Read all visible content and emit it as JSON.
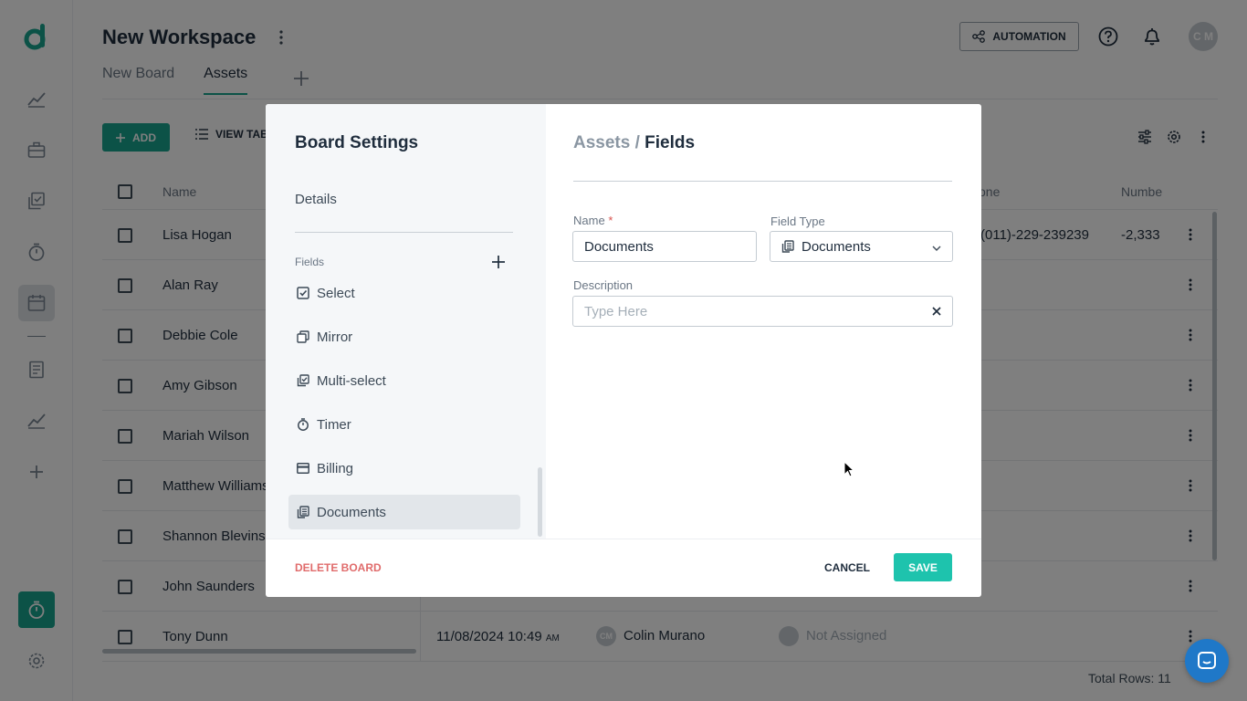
{
  "header": {
    "title": "New Workspace",
    "automation_label": "AUTOMATION",
    "avatar_initials": "C M"
  },
  "tabs": [
    {
      "label": "New Board"
    },
    {
      "label": "Assets"
    }
  ],
  "toolbar": {
    "add_label": "ADD",
    "view_label": "VIEW TAB"
  },
  "table": {
    "headers": {
      "name": "Name",
      "phone": "one",
      "number": "Numbe"
    },
    "rows": [
      {
        "name": "Lisa Hogan",
        "phone": "(011)-229-239239",
        "number": "-2,333"
      },
      {
        "name": "Alan Ray"
      },
      {
        "name": "Debbie Cole"
      },
      {
        "name": "Amy Gibson"
      },
      {
        "name": "Mariah Wilson"
      },
      {
        "name": "Matthew Williams"
      },
      {
        "name": "Shannon Blevins"
      },
      {
        "name": "John Saunders"
      },
      {
        "name": "Tony Dunn",
        "date": "11/08/2024 10:49",
        "ampm": "AM",
        "owner_initials": "CM",
        "owner": "Colin Murano",
        "assignee": "Not Assigned"
      }
    ],
    "total_rows": "Total Rows: 11"
  },
  "modal": {
    "title": "Board Settings",
    "nav_details": "Details",
    "fields_label": "Fields",
    "field_items": [
      {
        "label": "Select",
        "icon": "checkbox-icon"
      },
      {
        "label": "Mirror",
        "icon": "mirror-icon"
      },
      {
        "label": "Multi-select",
        "icon": "multi-select-icon"
      },
      {
        "label": "Timer",
        "icon": "timer-icon"
      },
      {
        "label": "Billing",
        "icon": "billing-card-icon"
      },
      {
        "label": "Documents",
        "icon": "documents-icon"
      }
    ],
    "breadcrumb": {
      "parent": "Assets",
      "separator": "/",
      "current": "Fields"
    },
    "name_label": "Name",
    "name_required": "*",
    "name_value": "Documents",
    "field_type_label": "Field Type",
    "field_type_value": "Documents",
    "description_label": "Description",
    "description_placeholder": "Type Here",
    "delete_label": "DELETE BOARD",
    "cancel_label": "CANCEL",
    "save_label": "SAVE"
  },
  "colors": {
    "brand": "#18a58f",
    "save": "#1ec3ad",
    "danger": "#e06b6b",
    "chat": "#1f78c8"
  }
}
